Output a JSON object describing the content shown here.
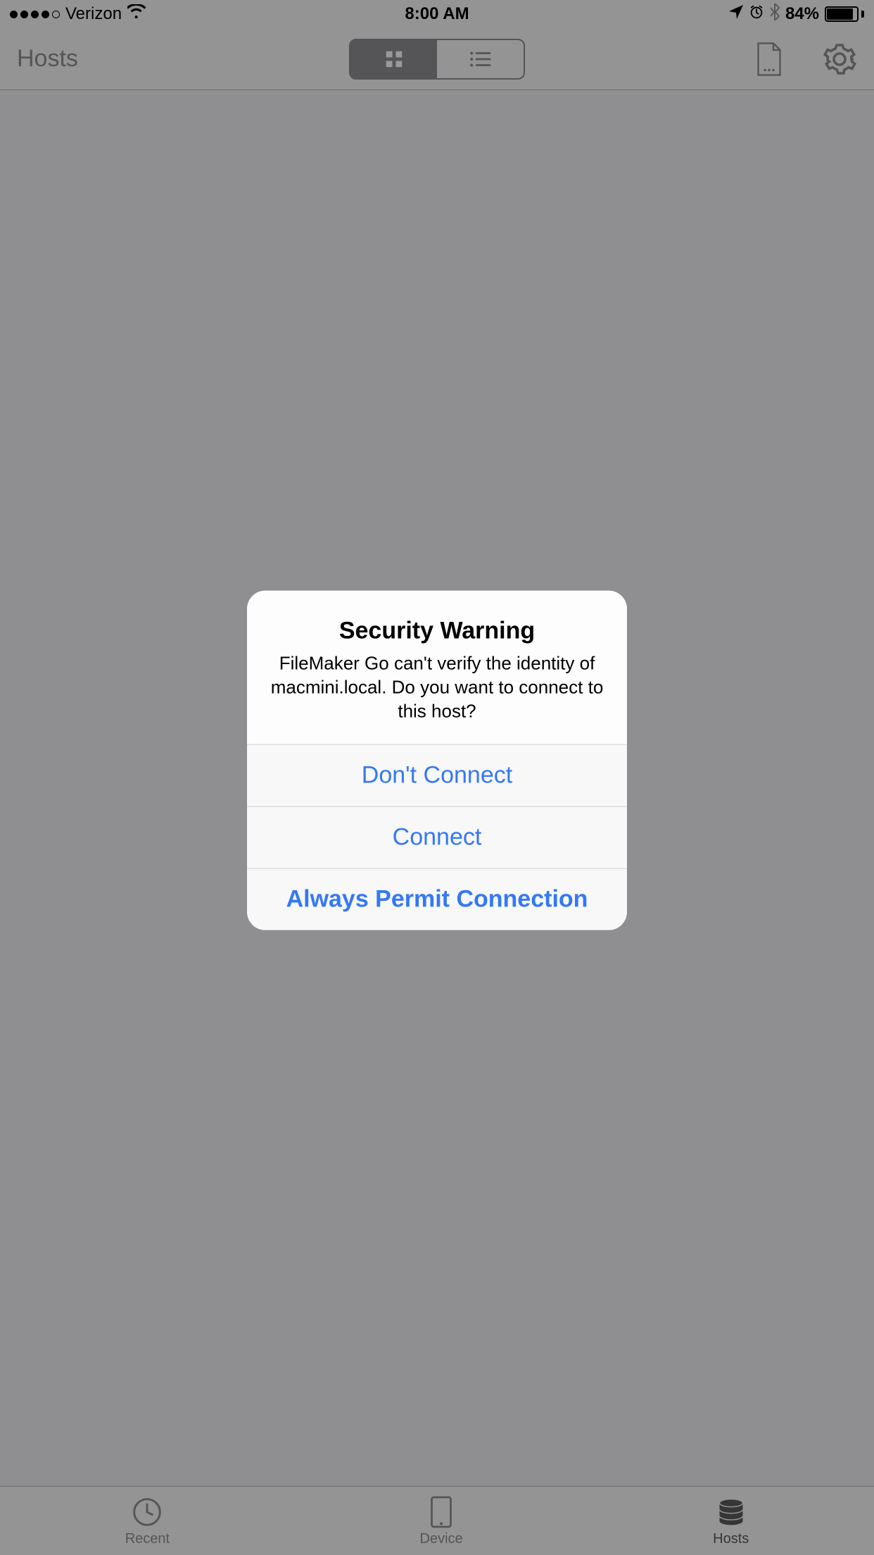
{
  "status_bar": {
    "carrier": "Verizon",
    "time": "8:00 AM",
    "battery_pct": "84%"
  },
  "navbar": {
    "title": "Hosts"
  },
  "tabbar": {
    "recent": "Recent",
    "device": "Device",
    "hosts": "Hosts"
  },
  "alert": {
    "title": "Security Warning",
    "message": "FileMaker Go can't verify the identity of macmini.local. Do you want to connect to this host?",
    "buttons": {
      "dont_connect": "Don't Connect",
      "connect": "Connect",
      "always": "Always Permit Connection"
    }
  }
}
